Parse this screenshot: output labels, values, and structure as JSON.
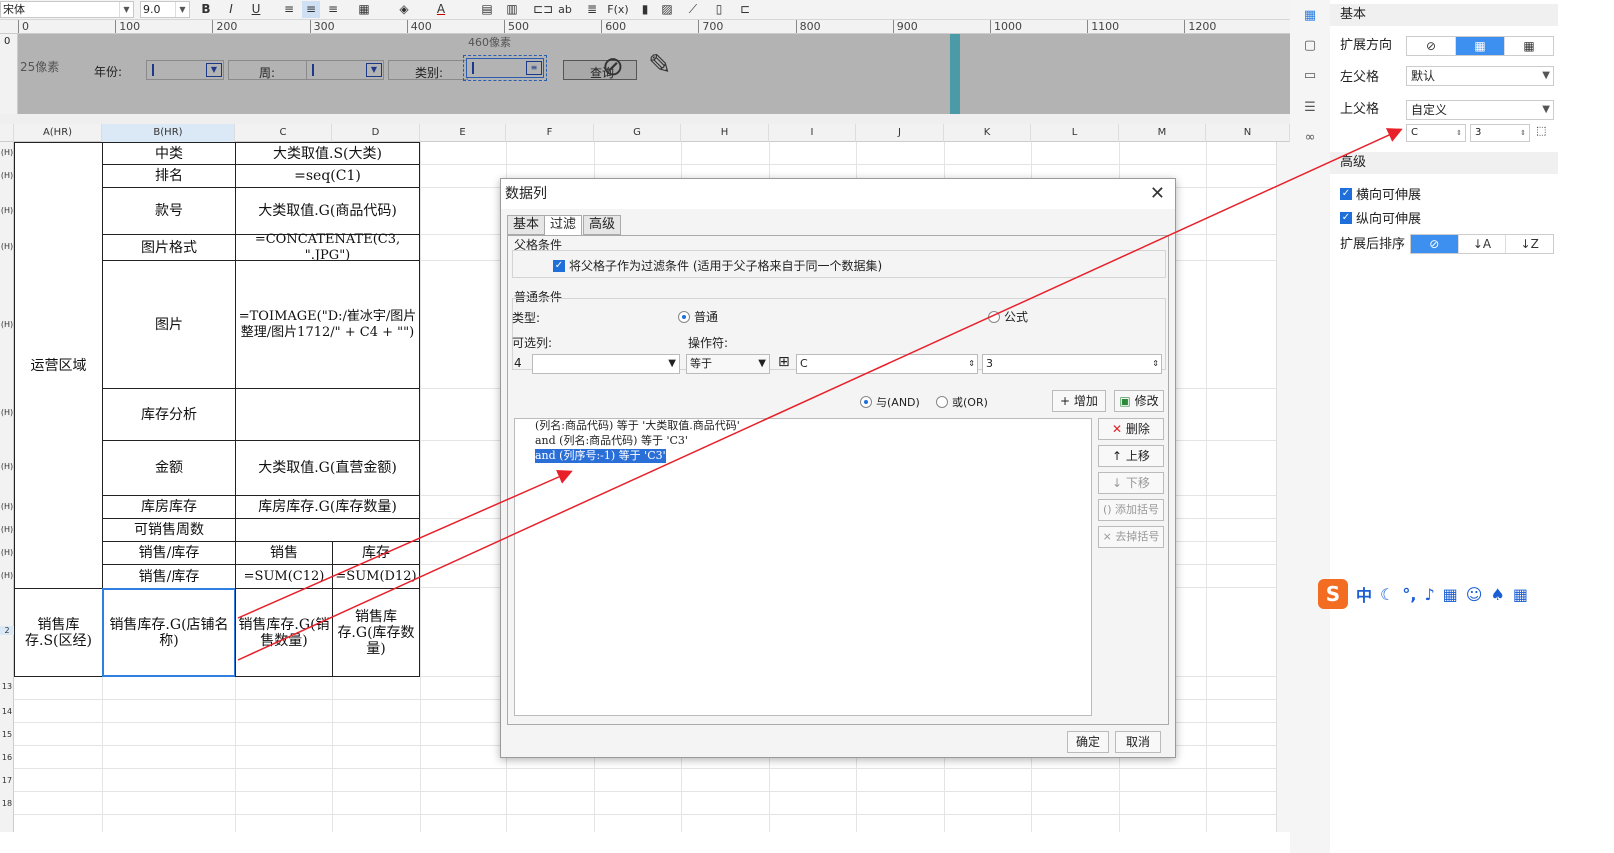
{
  "toolbar": {
    "font_family": "宋体",
    "font_size": "9.0",
    "bold": "B",
    "italic": "I",
    "underline": "U",
    "text_color_icon": "A",
    "ab": "ab",
    "fx": "F(x)"
  },
  "ruler": {
    "ticks": [
      "0",
      "100",
      "200",
      "300",
      "400",
      "500",
      "600",
      "700",
      "800",
      "900",
      "1000",
      "1100",
      "1200"
    ],
    "px_label_v": "25像素",
    "px_label_h": "460像素"
  },
  "param_bar": {
    "year_label": "年份:",
    "week_label": "周:",
    "category_label": "类别:",
    "query_label": "查询"
  },
  "columns": [
    "A(HR)",
    "B(HR)",
    "C",
    "D",
    "E",
    "F",
    "G",
    "H",
    "I",
    "J",
    "K",
    "L",
    "M",
    "N"
  ],
  "row_numbers": [
    "(H)",
    "(H)",
    "(H)",
    "(H)",
    "(H)",
    "(H)",
    "(H)",
    "(H)",
    "(H)",
    "(H)",
    "(H)",
    "2",
    "13",
    "14",
    "15",
    "16",
    "17",
    "18"
  ],
  "sheet": {
    "region": "运营区域",
    "r1_label": "中类",
    "r1_value": "大类取值.S(大类)",
    "r2_label": "排名",
    "r2_value": "=seq(C1)",
    "r3_label": "款号",
    "r3_value": "大类取值.G(商品代码)",
    "r4_label": "图片格式",
    "r4_value": "=CONCATENATE(C3, \".JPG\")",
    "r5_label": "图片",
    "r5_value": "=TOIMAGE(\"D:/崔冰宇/图片整理/图片1712/\" + C4 + \"\")",
    "r6_label": "库存分析",
    "r7_label": "金额",
    "r7_value": "大类取值.G(直营金额)",
    "r8_label": "库房库存",
    "r8_value": "库房库存.G(库存数量)",
    "r9_label": "可销售周数",
    "r10_label": "销售/库存",
    "r10_c": "销售",
    "r10_d": "库存",
    "r11_label": "销售/库存",
    "r11_c": "=SUM(C12)",
    "r11_d": "=SUM(D12)",
    "r12_a": "销售库存.S(区经)",
    "r12_b": "销售库存.G(店铺名称)",
    "r12_c": "销售库存.G(销售数量)",
    "r12_d": "销售库存.G(库存数量)"
  },
  "dialog": {
    "title": "数据列",
    "tabs": [
      "基本",
      "过滤",
      "高级"
    ],
    "parent_cond_title": "父格条件",
    "parent_cond_checkbox": "将父格子作为过滤条件 (适用于父子格来自于同一个数据集)",
    "normal_cond_title": "普通条件",
    "type_label": "类型:",
    "type_normal": "普通",
    "type_formula": "公式",
    "optional_col_label": "可选列:",
    "operator_label": "操作符:",
    "col_num": "4",
    "operator_value": "等于",
    "cell_col": "C",
    "cell_row": "3",
    "and_label": "与(AND)",
    "or_label": "或(OR)",
    "add_btn": "增加",
    "modify_btn": "修改",
    "delete_btn": "删除",
    "up_btn": "上移",
    "down_btn": "下移",
    "add_paren_btn": "添加括号",
    "remove_paren_btn": "去掉括号",
    "conditions": [
      "(列名:商品代码) 等于 '大类取值.商品代码'",
      "and (列名:商品代码) 等于 'C3'",
      "and (列序号:-1) 等于 'C3'"
    ],
    "ok_btn": "确定",
    "cancel_btn": "取消"
  },
  "props": {
    "basic_title": "基本",
    "expand_dir_label": "扩展方向",
    "left_parent_label": "左父格",
    "left_parent_value": "默认",
    "top_parent_label": "上父格",
    "top_parent_value": "自定义",
    "top_parent_col": "C",
    "top_parent_row": "3",
    "advanced_title": "高级",
    "h_expand": "横向可伸展",
    "v_expand": "纵向可伸展",
    "sort_label": "扩展后排序"
  },
  "ime": {
    "logo": "S",
    "zh": "中"
  }
}
